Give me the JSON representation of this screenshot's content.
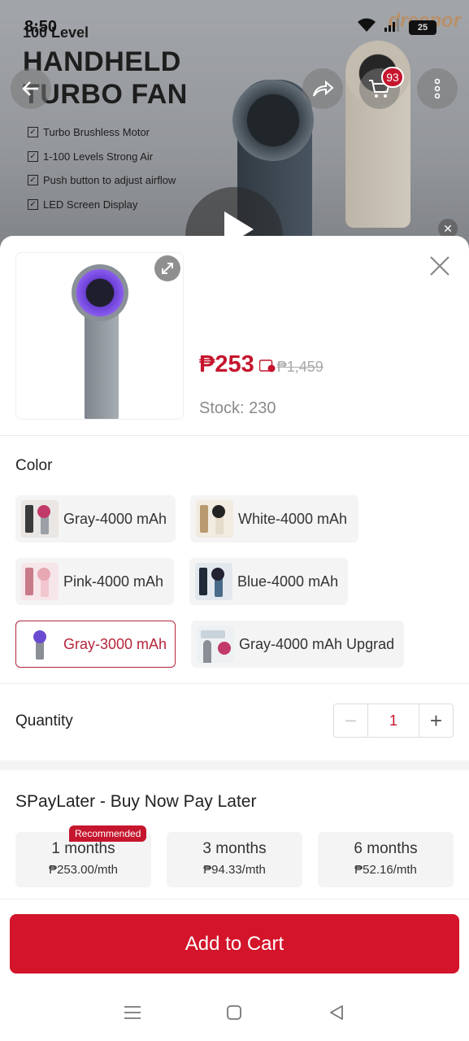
{
  "status_bar": {
    "time": "8:50",
    "battery": "25"
  },
  "banner": {
    "brand": "dreepor",
    "subtitle": "100 Level",
    "title_line1": "HANDHELD",
    "title_line2": "TURBO FAN",
    "features": [
      "Turbo Brushless Motor",
      "1-100 Levels Strong Air",
      "Push button to adjust airflow",
      "LED Screen Display"
    ],
    "cart_count": "93"
  },
  "product": {
    "price": "₱253",
    "original_price": "₱1,459",
    "stock": "Stock: 230"
  },
  "color": {
    "label": "Color",
    "options": [
      {
        "label": "Gray-4000 mAh",
        "selected": false,
        "accent": "#c23a6a"
      },
      {
        "label": "White-4000 mAh",
        "selected": false,
        "accent": "#e6dccb"
      },
      {
        "label": "Pink-4000 mAh",
        "selected": false,
        "accent": "#e7a8b4"
      },
      {
        "label": "Blue-4000 mAh",
        "selected": false,
        "accent": "#4a6a8a"
      },
      {
        "label": "Gray-3000 mAh",
        "selected": true,
        "accent": "#6a4bd0"
      },
      {
        "label": "Gray-4000 mAh Upgrad",
        "selected": false,
        "accent": "#8a8f95"
      }
    ]
  },
  "quantity": {
    "label": "Quantity",
    "value": "1",
    "minus": "−",
    "plus": "+"
  },
  "spaylater": {
    "title": "SPayLater - Buy Now Pay Later",
    "recommended": "Recommended",
    "plans": [
      {
        "months": "1 months",
        "price": "₱253.00/mth"
      },
      {
        "months": "3 months",
        "price": "₱94.33/mth"
      },
      {
        "months": "6 months",
        "price": "₱52.16/mth"
      }
    ]
  },
  "actions": {
    "add_to_cart": "Add to Cart"
  },
  "colors": {
    "accent": "#d3142a",
    "selected_border": "#b5263a"
  }
}
